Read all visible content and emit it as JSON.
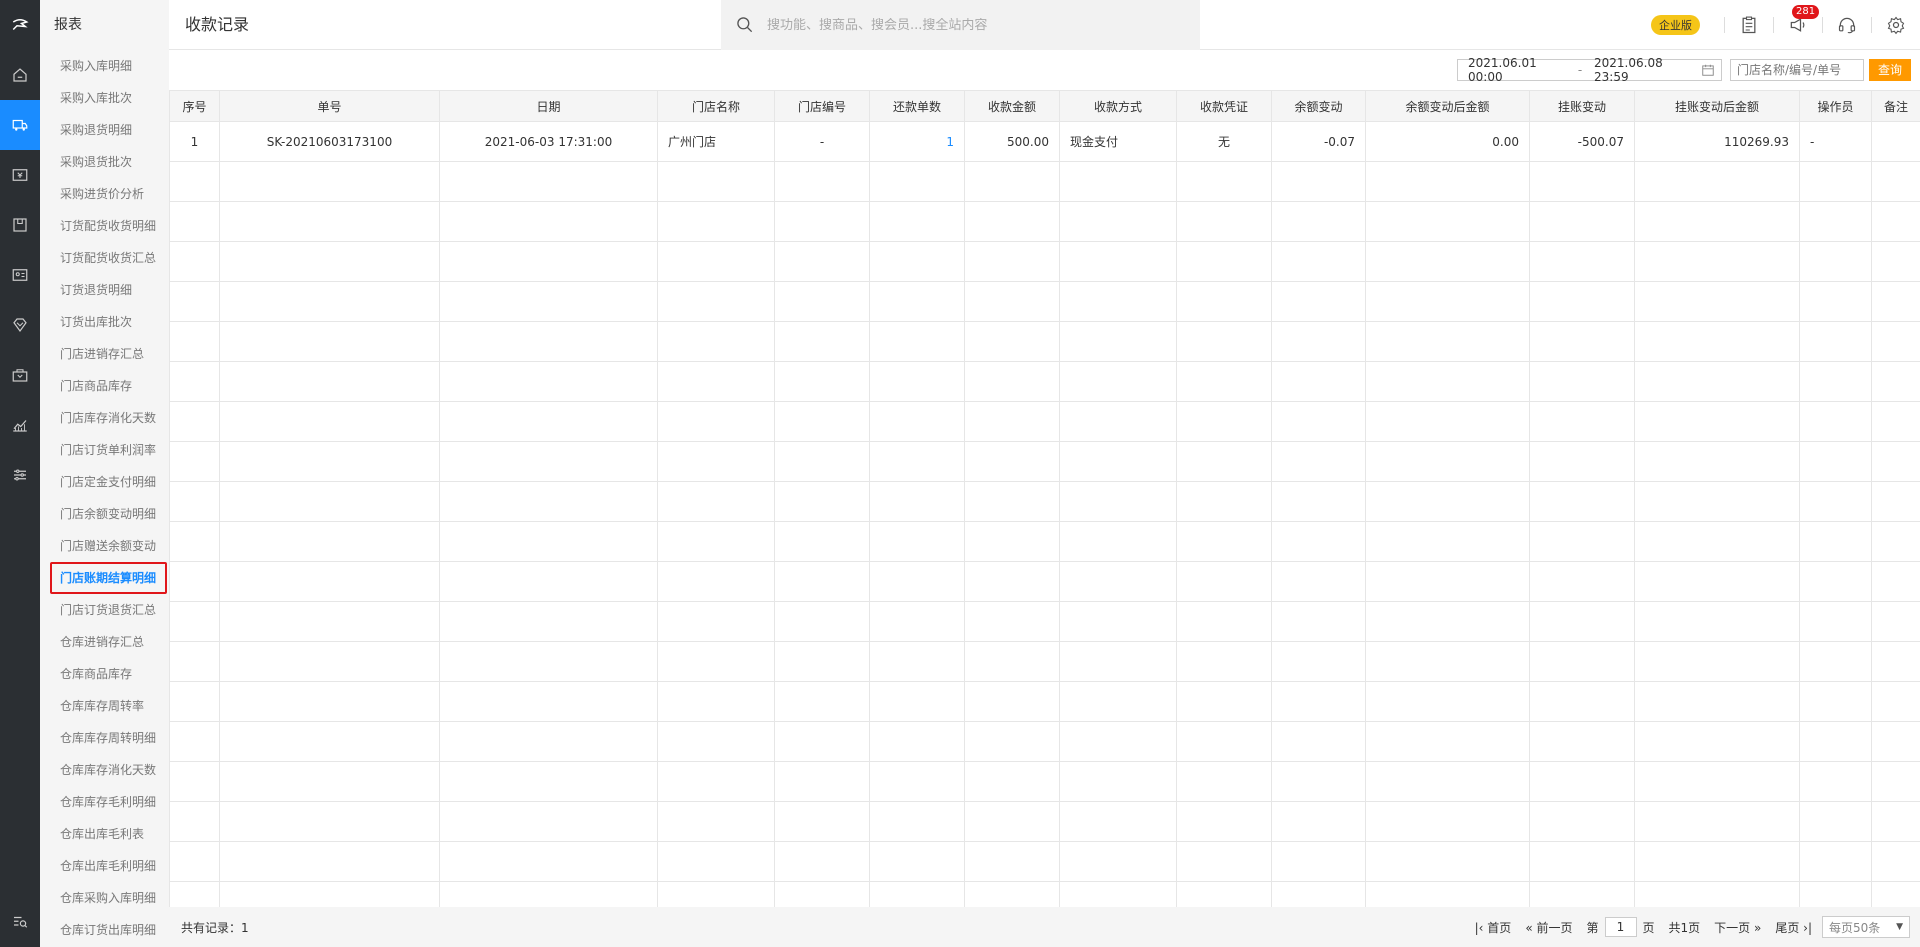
{
  "submenu": {
    "heading": "报表",
    "items": [
      "采购入库明细",
      "采购入库批次",
      "采购退货明细",
      "采购退货批次",
      "采购进货价分析",
      "订货配货收货明细",
      "订货配货收货汇总",
      "订货退货明细",
      "订货出库批次",
      "门店进销存汇总",
      "门店商品库存",
      "门店库存消化天数",
      "门店订货单利润率",
      "门店定金支付明细",
      "门店余额变动明细",
      "门店赠送余额变动",
      "门店账期结算明细",
      "门店订货退货汇总",
      "仓库进销存汇总",
      "仓库商品库存",
      "仓库库存周转率",
      "仓库库存周转明细",
      "仓库库存消化天数",
      "仓库库存毛利明细",
      "仓库出库毛利表",
      "仓库出库毛利明细",
      "仓库采购入库明细",
      "仓库订货出库明细"
    ],
    "active_index": 16
  },
  "header": {
    "title": "收款记录",
    "search_placeholder": "搜功能、搜商品、搜会员...搜全站内容",
    "edition_badge": "企业版",
    "notification_count": "281"
  },
  "filters": {
    "date_start": "2021.06.01 00:00",
    "date_sep": "-",
    "date_end": "2021.06.08 23:59",
    "store_placeholder": "门店名称/编号/单号",
    "query_label": "查询"
  },
  "table": {
    "columns": [
      "序号",
      "单号",
      "日期",
      "门店名称",
      "门店编号",
      "还款单数",
      "收款金额",
      "收款方式",
      "收款凭证",
      "余额变动",
      "余额变动后金额",
      "挂账变动",
      "挂账变动后金额",
      "操作员",
      "备注"
    ],
    "rows": [
      [
        "1",
        "SK-20210603173100",
        "2021-06-03 17:31:00",
        "广州门店",
        "-",
        "1",
        "500.00",
        "现金支付",
        "无",
        "-0.07",
        "0.00",
        "-500.07",
        "110269.93",
        "-",
        ""
      ]
    ]
  },
  "footer": {
    "total_label": "共有记录：1",
    "first": "首页",
    "prev": "前一页",
    "page_prefix": "第",
    "page_value": "1",
    "page_suffix": "页",
    "page_total": "共1页",
    "next": "下一页",
    "last": "尾页",
    "per_page": "每页50条"
  },
  "colors": {
    "accent": "#1a8cff",
    "query_button": "#ff9900",
    "highlight_border": "#e0161a",
    "rail_bg": "#2b2f33"
  },
  "rail_icons": [
    "logo-icon",
    "home-icon",
    "purchase-icon",
    "sales-icon",
    "inventory-icon",
    "member-icon",
    "marketing-icon",
    "finance-icon",
    "report-icon",
    "settings-icon",
    "search-menu-icon"
  ]
}
